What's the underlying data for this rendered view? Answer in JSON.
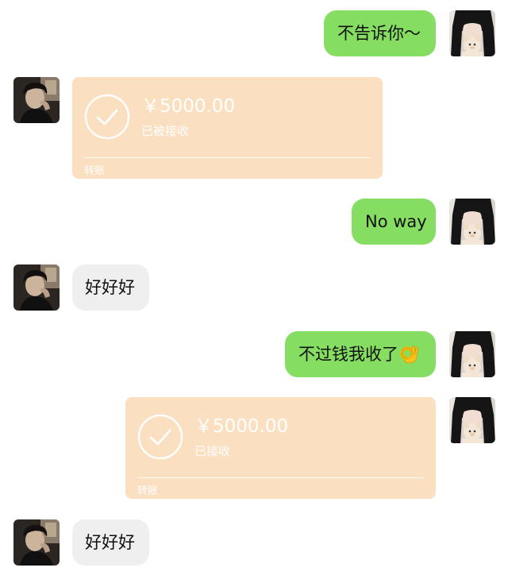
{
  "messages": [
    {
      "side": "right",
      "type": "text",
      "text": "不告诉你～"
    },
    {
      "side": "left",
      "type": "transfer",
      "amount": "￥5000.00",
      "status": "已被接收",
      "footer": "转账"
    },
    {
      "side": "right",
      "type": "text",
      "text": "No way"
    },
    {
      "side": "left",
      "type": "text",
      "text": "好好好"
    },
    {
      "side": "right",
      "type": "text",
      "text": "不过钱我收了",
      "emoji": "ok-hand-emoji"
    },
    {
      "side": "right",
      "type": "transfer",
      "amount": "￥5000.00",
      "status": "已接收",
      "footer": "转账"
    },
    {
      "side": "left",
      "type": "text",
      "text": "好好好"
    }
  ],
  "colors": {
    "outgoing_bubble": "#85de61",
    "incoming_bubble": "#efefef",
    "transfer_card": "#fbdfc1",
    "transfer_text": "#ffffff"
  },
  "icons": {
    "self_avatar": "girl-with-bear-avatar",
    "other_avatar": "dark-portrait-avatar",
    "transfer_received": "check-circle-icon"
  }
}
